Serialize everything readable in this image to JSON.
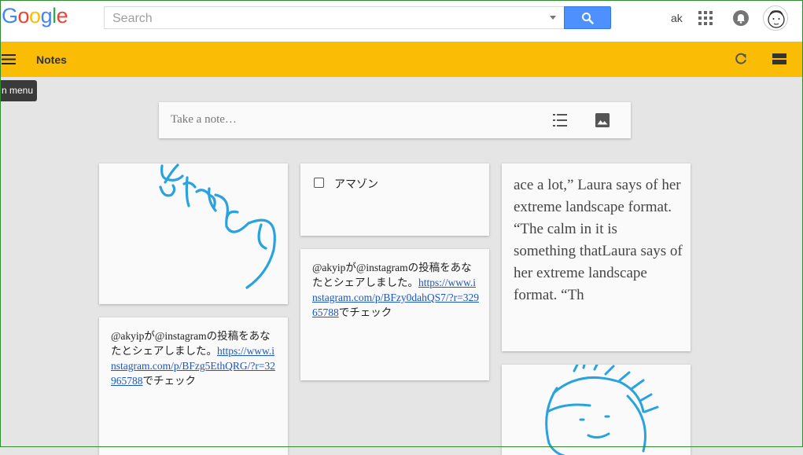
{
  "google_bar": {
    "logo": "Google",
    "search_placeholder": "Search",
    "user_initials": "ak"
  },
  "app_bar": {
    "title": "Notes",
    "tooltip": "n menu"
  },
  "composer": {
    "placeholder": "Take a note…"
  },
  "notes": {
    "checklist_note": {
      "item_label": "アマゾン",
      "checked": false
    },
    "share_note_1": {
      "text_before": "@akyipが@instagramの投稿をあなたとシェアしました。",
      "link": "https://www.instagram.com/p/BFzy0dahQS7/?r=32965788",
      "text_after": "でチェック"
    },
    "share_note_2": {
      "text_before": "@akyipが@instagramの投稿をあなたとシェアしました。",
      "link": "https://www.instagram.com/p/BFzg5EthQRG/?r=32965788",
      "text_after": "でチェック"
    },
    "quote_note": {
      "text": "ace a lot,” Laura says of her extreme landscape format. “The calm in it is something thatLaura says of her extreme landscape format. “Th"
    }
  },
  "icons": {
    "search": "search-icon",
    "apps": "apps-grid-icon",
    "notifications": "bell-icon",
    "menu": "hamburger-menu-icon",
    "refresh": "refresh-icon",
    "view": "list-view-icon",
    "new_list": "checklist-icon",
    "new_image": "image-icon"
  },
  "colors": {
    "app_bar": "#fbbc05",
    "search_button": "#4d90fe",
    "ink": "#29a3e0",
    "link": "#1a56c4"
  }
}
